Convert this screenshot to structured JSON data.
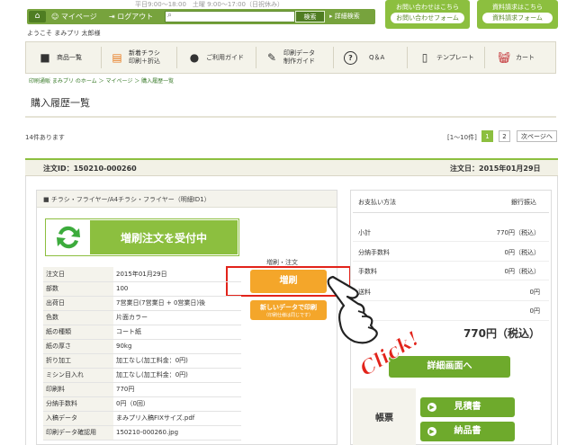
{
  "header": {
    "top_info": "平日9:00～18:00　土曜 9:00～17:00（日祝休み）",
    "home_icon": "home-icon",
    "mypage": "マイページ",
    "logout": "ログアウト",
    "search_placeholder": "",
    "search_button": "検索",
    "advanced_search": "詳細検索",
    "contact_title": "お問い合わせはこちら",
    "contact_button": "お問い合わせフォーム",
    "docs_title": "資料請求はこちら",
    "docs_button": "資料請求フォーム",
    "tagline": "ようこそ まみプリ 太郎様"
  },
  "nav": {
    "items": [
      {
        "label": "商品一覧",
        "icon": "box-icon"
      },
      {
        "label": "新着チラシ\n印刷＋折込",
        "icon": "flyer-icon"
      },
      {
        "label": "ご利用ガイド",
        "icon": "guide-icon"
      },
      {
        "label": "印刷データ\n制作ガイド",
        "icon": "document-icon"
      },
      {
        "label": "Q＆A",
        "icon": "question-icon"
      },
      {
        "label": "テンプレート",
        "icon": "template-icon"
      },
      {
        "label": "カート",
        "icon": "cart-icon"
      }
    ]
  },
  "breadcrumb": "印刷通販 まみプリ のホーム ＞ マイページ ＞ 購入履歴一覧",
  "page_title": "購入履歴一覧",
  "list": {
    "count": "14件あります",
    "range": "[1～10件]",
    "page1": "1",
    "page2": "2",
    "next": "次ページへ"
  },
  "order": {
    "number_label": "注文ID：150210-000260",
    "date_label": "注文日：2015年01月29日",
    "product_title": "チラシ・フライヤー/A4チラシ・フライヤー（明細ID1）",
    "banner_text": "増刷注文を受付中",
    "reorder_label": "増刷・注文",
    "reorder_button": "増刷",
    "new_data_button": "新しいデータで印刷",
    "new_data_sub": "（印刷仕様は同じです）",
    "specs": [
      {
        "k": "注文日",
        "v": "2015年01月29日"
      },
      {
        "k": "部数",
        "v": "100"
      },
      {
        "k": "出荷日",
        "v": "7営業日(7営業日 + 0営業日)後"
      },
      {
        "k": "色数",
        "v": "片面カラー"
      },
      {
        "k": "紙の種類",
        "v": "コート紙"
      },
      {
        "k": "紙の厚さ",
        "v": "90kg"
      },
      {
        "k": "折り加工",
        "v": "加工なし(加工料金：0円)"
      },
      {
        "k": "ミシン目入れ",
        "v": "加工なし(加工料金：0円)"
      },
      {
        "k": "印刷料",
        "v": "770円"
      },
      {
        "k": "分納手数料",
        "v": "0円（0回）"
      },
      {
        "k": "入稿データ",
        "v": "まみプリ入稿FIXサイズ.pdf"
      },
      {
        "k": "印刷データ確認用",
        "v": "150210-000260.jpg"
      }
    ],
    "payment_label": "お支払い方法",
    "payment_value": "銀行振込",
    "summary": [
      {
        "k": "小計",
        "v": "770円（税込）"
      },
      {
        "k": "分納手数料",
        "v": "0円（税込）"
      },
      {
        "k": "手数料",
        "v": "0円（税込）"
      },
      {
        "k": "送料",
        "v": "0円"
      },
      {
        "k": "",
        "v": "0円"
      }
    ],
    "total": "770円（税込）",
    "detail_button": "詳細画面へ",
    "docs_label": "帳票",
    "estimate_button": "見積書",
    "delivery_button": "納品書"
  },
  "overlay": {
    "click_text": "Click!",
    "hand_icon": "pointing-hand-icon"
  },
  "colors": {
    "brand_green": "#77a33d",
    "light_green": "#8cbf3f",
    "orange": "#f4a62a",
    "red": "#e2231a"
  }
}
